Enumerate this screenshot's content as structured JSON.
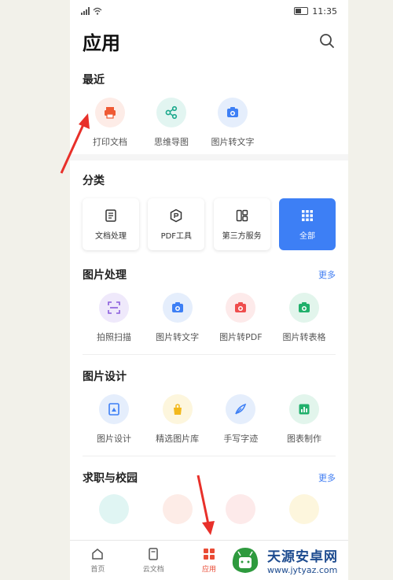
{
  "status": {
    "time": "11:35"
  },
  "header": {
    "title": "应用"
  },
  "recent": {
    "title": "最近",
    "items": [
      {
        "label": "打印文档",
        "icon": "printer-icon"
      },
      {
        "label": "思维导图",
        "icon": "share-nodes-icon"
      },
      {
        "label": "图片转文字",
        "icon": "image-text-icon"
      }
    ]
  },
  "categories": {
    "title": "分类",
    "items": [
      {
        "label": "文档处理",
        "icon": "document-icon"
      },
      {
        "label": "PDF工具",
        "icon": "pdf-hexagon-icon"
      },
      {
        "label": "第三方服务",
        "icon": "grid-apps-icon"
      },
      {
        "label": "全部",
        "icon": "dots-grid-icon"
      }
    ]
  },
  "image_processing": {
    "title": "图片处理",
    "more": "更多",
    "items": [
      {
        "label": "拍照扫描",
        "icon": "scan-icon"
      },
      {
        "label": "图片转文字",
        "icon": "image-text-icon"
      },
      {
        "label": "图片转PDF",
        "icon": "image-pdf-icon"
      },
      {
        "label": "图片转表格",
        "icon": "image-table-icon"
      }
    ]
  },
  "image_design": {
    "title": "图片设计",
    "items": [
      {
        "label": "图片设计",
        "icon": "image-design-icon"
      },
      {
        "label": "精选图片库",
        "icon": "image-library-icon"
      },
      {
        "label": "手写字迹",
        "icon": "quill-icon"
      },
      {
        "label": "图表制作",
        "icon": "bar-chart-icon"
      }
    ]
  },
  "career": {
    "title": "求职与校园",
    "more": "更多"
  },
  "tabbar": {
    "items": [
      {
        "label": "首页",
        "icon": "home-icon"
      },
      {
        "label": "云文档",
        "icon": "cloud-doc-icon"
      },
      {
        "label": "应用",
        "icon": "apps-icon"
      }
    ]
  },
  "watermark": {
    "title": "天源安卓网",
    "url": "www.jytyaz.com"
  },
  "colors": {
    "accent": "#3d7ff5",
    "active_tab": "#e94b35",
    "more_link": "#3f7cf2",
    "arrow": "#e8302a"
  }
}
